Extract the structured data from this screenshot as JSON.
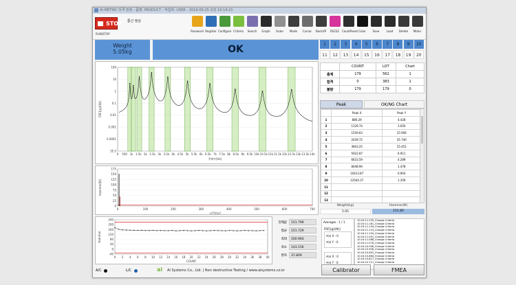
{
  "window": {
    "title": "AI-METRIC 타격 판정 - 품명: PRODUCT - 작업자: USER - 2019-09-25 오전 10:14:21"
  },
  "toolbar": {
    "stop_label": "STOP",
    "stop_caption": "RUN/STOP",
    "comm_status": "통신 정상",
    "tools": [
      {
        "icon": "key-icon",
        "label": "Password",
        "color": "#e7a51b"
      },
      {
        "icon": "register-icon",
        "label": "Register",
        "color": "#2e6fb8"
      },
      {
        "icon": "configure-icon",
        "label": "Configure",
        "color": "#4a9a3b"
      },
      {
        "icon": "criteria-icon",
        "label": "Criteria",
        "color": "#7cbf3e"
      },
      {
        "icon": "search-icon",
        "label": "Search",
        "color": "#7b6fb0"
      },
      {
        "icon": "graph-icon",
        "label": "Graph",
        "color": "#2a2a2a"
      },
      {
        "icon": "scale-icon",
        "label": "Scale",
        "color": "#909090"
      },
      {
        "icon": "mode-icon",
        "label": "Mode",
        "color": "#3d3d3d"
      },
      {
        "icon": "cursor-icon",
        "label": "Cursor",
        "color": "#6d6d6d"
      },
      {
        "icon": "backup-icon",
        "label": "BackUP",
        "color": "#3d3d3d"
      },
      {
        "icon": "rss-icon",
        "label": "RS232",
        "color": "#d6339b"
      },
      {
        "icon": "reset-icon",
        "label": "CountReset",
        "color": "#2f2f2f"
      },
      {
        "icon": "color-icon",
        "label": "Color",
        "color": "#111111"
      },
      {
        "icon": "save-icon",
        "label": "Save",
        "color": "#2c2c2c"
      },
      {
        "icon": "load-icon",
        "label": "Load",
        "color": "#2c2c2c"
      },
      {
        "icon": "delete-icon",
        "label": "Delete",
        "color": "#3a3a3a"
      },
      {
        "icon": "motor-icon",
        "label": "Motor",
        "color": "#3a3a3a"
      }
    ]
  },
  "result": {
    "weight_label": "Weight",
    "weight_value": "5.05kg",
    "judgement": "OK"
  },
  "grid_numbers": [
    "1",
    "2",
    "3",
    "4",
    "5",
    "6",
    "7",
    "8",
    "9",
    "10",
    "11",
    "12",
    "13",
    "14",
    "15",
    "16",
    "17",
    "18",
    "19",
    "20"
  ],
  "counts": {
    "headers": [
      "",
      "COUNT",
      "LOT",
      "Chart"
    ],
    "rows": [
      {
        "label": "총계",
        "count": "179",
        "lot": "562",
        "chart": "1"
      },
      {
        "label": "합격",
        "count": "0",
        "lot": "383",
        "chart": "1"
      },
      {
        "label": "불량",
        "count": "179",
        "lot": "179",
        "chart": "0"
      }
    ]
  },
  "tabs": {
    "peak": "Peak",
    "okng": "OK/NG Chart"
  },
  "peak_table": {
    "headers": [
      "Peak X",
      "Peak Y"
    ],
    "rows": [
      {
        "n": "1",
        "x": "880.29",
        "y": "4.428"
      },
      {
        "n": "2",
        "x": "1129.74",
        "y": "3.050"
      },
      {
        "n": "3",
        "x": "1559.63",
        "y": "15.956"
      },
      {
        "n": "4",
        "x": "2439.72",
        "y": "35.740"
      },
      {
        "n": "5",
        "x": "3603.25",
        "y": "15.451"
      },
      {
        "n": "6",
        "x": "5022.87",
        "y": "6.911"
      },
      {
        "n": "7",
        "x": "6633.59",
        "y": "4.289"
      },
      {
        "n": "8",
        "x": "8448.90",
        "y": "1.478"
      },
      {
        "n": "9",
        "x": "10413.87",
        "y": "0.993"
      },
      {
        "n": "10",
        "x": "12504.37",
        "y": "1.359"
      },
      {
        "n": "11",
        "x": "",
        "y": ""
      },
      {
        "n": "12",
        "x": "",
        "y": ""
      },
      {
        "n": "13",
        "x": "",
        "y": ""
      },
      {
        "n": "14",
        "x": "",
        "y": ""
      },
      {
        "n": "15",
        "x": "",
        "y": ""
      }
    ]
  },
  "weight_hammer": {
    "weight_label": "Weight(kg)",
    "hammer_label": "Hammer(N)",
    "weight": "5.05",
    "hammer": "151.80"
  },
  "stats": [
    {
      "label": "현재값",
      "value": "151.799"
    },
    {
      "label": "평균",
      "value": "151.729"
    },
    {
      "label": "최대",
      "value": "160.964"
    },
    {
      "label": "최소",
      "value": "143.156"
    },
    {
      "label": "편차",
      "value": "37.809"
    }
  ],
  "averages": {
    "label": "Averages :",
    "value": "1 / 1",
    "frf_label": "FRF[(g)/(N)]",
    "cursor_x": "커서 X : 0",
    "cursor_y": "커서 Y : 0",
    "cursor_x2": "커서 X : 0",
    "cursor_y2": "커서 Y : 0"
  },
  "log": [
    "10:24:11.239_Change Criteria",
    "10:24:11.181_Change Criteria",
    "10:24:11.154_Change Criteria",
    "10:24:11.123_Change Criteria",
    "10:24:11.104_Change Criteria",
    "10:24:11.091_Change Criteria",
    "10:24:11.088_Change Criteria",
    "10:24:11.076_Change Criteria",
    "10:24:10.996_Change Criteria",
    "10:24:10.928_Change Criteria",
    "10:24:10.891_Change Criteria",
    "10:24:10.864_Change Criteria",
    "10:24:10.817_Change Criteria",
    "10:24:10.711_Change Criteria"
  ],
  "footer": {
    "ac_label": "A/C",
    "lc_label": "L/C",
    "company": "AI Systems Co., Ltd. | Non destructive Testing  / www.aisystems.co.kr"
  },
  "buttons": {
    "calibrator": "Calibrator",
    "fmea": "FMEA"
  },
  "chart_data": [
    {
      "type": "line",
      "ylabel": "FRF[(g)/(N)]",
      "xlabel": "주파수[Hz]",
      "yscale": "log",
      "ylim": [
        1e-05,
        100
      ],
      "xlim": [
        0,
        14000
      ],
      "x_ticks": [
        "0",
        "500",
        "1k",
        "1.5k",
        "2k",
        "2.5k",
        "3k",
        "3.5k",
        "4k",
        "4.5k",
        "5k",
        "5.5k",
        "6k",
        "6.5k",
        "7k",
        "7.5k",
        "8k",
        "8.5k",
        "9k",
        "9.5k",
        "10k",
        "10.5k",
        "11k",
        "11.5k",
        "12k",
        "12.5k",
        "13k",
        "13.5k",
        "14k"
      ],
      "y_ticks": [
        "100",
        "10",
        "1",
        "0.1",
        "0.01",
        "0.001",
        "0.0001",
        "1E-5"
      ],
      "peaks_x": [
        880.29,
        1129.74,
        1559.63,
        2439.72,
        3603.25,
        5022.87,
        6633.59,
        8448.9,
        10413.87,
        12504.37
      ],
      "peaks_y": [
        4.428,
        3.05,
        15.956,
        35.74,
        15.451,
        6.911,
        4.289,
        1.478,
        0.993,
        1.359
      ]
    },
    {
      "type": "line",
      "ylabel": "Hammer[N]",
      "xlabel": "시간[ms]",
      "xlim": [
        0,
        700
      ],
      "ylim": [
        0,
        175
      ],
      "x_ticks": [
        "0",
        "100",
        "200",
        "300",
        "400",
        "500",
        "600",
        "700"
      ],
      "y_ticks": [
        "175",
        "150",
        "125",
        "100",
        "75",
        "50",
        "25",
        "0"
      ],
      "impulse_peak": 151.8
    },
    {
      "type": "line",
      "ylabel": "Hammer",
      "xlabel": "COUNT",
      "xlim": [
        0,
        40
      ],
      "ylim": [
        -40,
        240
      ],
      "x_ticks": [
        "0",
        "2",
        "4",
        "6",
        "8",
        "10",
        "12",
        "14",
        "16",
        "18",
        "20",
        "22",
        "24",
        "26",
        "28",
        "30",
        "32",
        "34",
        "36",
        "38",
        "40"
      ],
      "y_ticks": [
        "240",
        "200",
        "160",
        "120",
        "80",
        "40",
        "0",
        "-40"
      ],
      "upper_limit": 220,
      "lower_limit": -30,
      "values": [
        175,
        162,
        157,
        156,
        155,
        154,
        153,
        154,
        152,
        152,
        153,
        151,
        152,
        151,
        151,
        152,
        150,
        151,
        152,
        151,
        150,
        151,
        152,
        151,
        150,
        151,
        152,
        151,
        151,
        150,
        152,
        151,
        150,
        151,
        152,
        151,
        151,
        150,
        151,
        152
      ]
    }
  ]
}
